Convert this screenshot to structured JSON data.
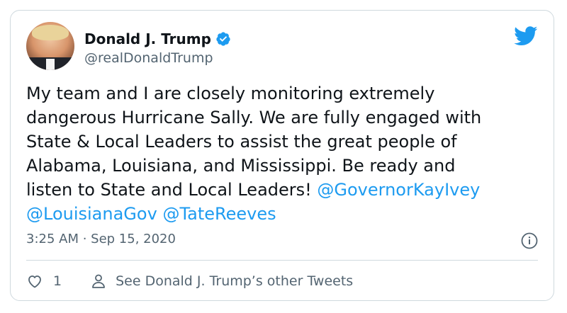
{
  "user": {
    "display_name": "Donald J. Trump",
    "handle": "@realDonaldTrump",
    "verified": true
  },
  "tweet": {
    "text_line_1": "My team and I are closely monitoring extremely",
    "text_line_2": "dangerous Hurricane Sally. We are fully engaged with",
    "text_line_3": "State & Local Leaders to assist the great people of",
    "text_line_4": "Alabama, Louisiana, and Mississippi. Be ready and",
    "text_line_5_prefix": "listen to State and Local Leaders! ",
    "mention_1": "@GovernorKayIvey",
    "mention_2": "@LouisianaGov",
    "mention_3": "@TateReeves",
    "timestamp": "3:25 AM · Sep 15, 2020"
  },
  "footer": {
    "like_count": "1",
    "other_tweets_label": "See Donald J. Trump’s other Tweets"
  },
  "colors": {
    "accent": "#1d9bf0",
    "text": "#0f1419",
    "secondary": "#536471",
    "border": "#cfd9de"
  },
  "icons": [
    "verified-badge-icon",
    "twitter-bird-icon",
    "info-icon",
    "heart-icon",
    "person-icon"
  ]
}
